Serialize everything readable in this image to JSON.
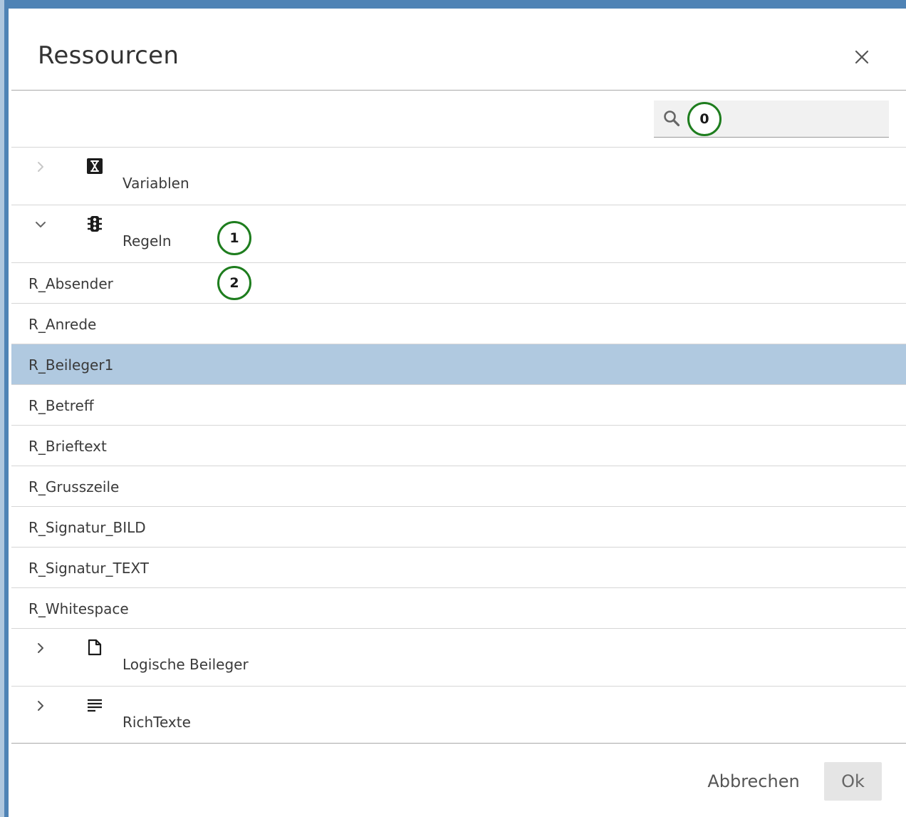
{
  "dialog": {
    "title": "Ressourcen",
    "close_icon": "close-icon"
  },
  "search": {
    "icon": "search-icon",
    "value": "",
    "placeholder": ""
  },
  "markers": {
    "search": "0",
    "regeln": "1",
    "absender": "2"
  },
  "tree": {
    "groups": [
      {
        "label": "Variablen",
        "icon": "variable-icon",
        "expanded": false
      },
      {
        "label": "Regeln",
        "icon": "traffic-light-icon",
        "expanded": true
      },
      {
        "label": "Logische Beileger",
        "icon": "document-icon",
        "expanded": false
      },
      {
        "label": "RichTexte",
        "icon": "text-lines-icon",
        "expanded": false
      }
    ],
    "rules": [
      {
        "label": "R_Absender",
        "selected": false
      },
      {
        "label": "R_Anrede",
        "selected": false
      },
      {
        "label": "R_Beileger1",
        "selected": true
      },
      {
        "label": "R_Betreff",
        "selected": false
      },
      {
        "label": "R_Brieftext",
        "selected": false
      },
      {
        "label": "R_Grusszeile",
        "selected": false
      },
      {
        "label": "R_Signatur_BILD",
        "selected": false
      },
      {
        "label": "R_Signatur_TEXT",
        "selected": false
      },
      {
        "label": "R_Whitespace",
        "selected": false
      }
    ]
  },
  "footer": {
    "cancel_label": "Abbrechen",
    "ok_label": "Ok"
  },
  "colors": {
    "selected_row": "#b0c9e0",
    "marker_ring": "#1e7d1e",
    "backdrop": "#4f83b5"
  }
}
